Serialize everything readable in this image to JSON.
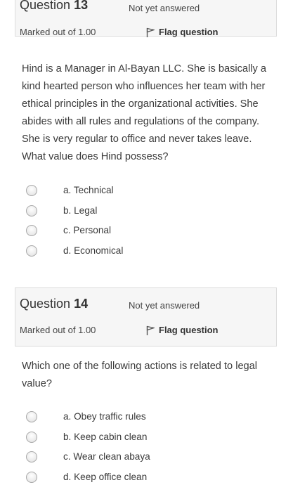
{
  "questions": [
    {
      "label": "Question",
      "number": "13",
      "state": "Not yet answered",
      "grade": "Marked out of 1.00",
      "flag_label": "Flag question",
      "text": "Hind is a Manager in Al-Bayan LLC. She is basically a kind hearted person who influences her team with her ethical principles in the organizational activities. She abides with all rules and regulations of the company. She is very regular to office and never takes leave. What value does Hind possess?",
      "answers": [
        "a. Technical",
        "b. Legal",
        "c. Personal",
        "d. Economical"
      ]
    },
    {
      "label": "Question",
      "number": "14",
      "state": "Not yet answered",
      "grade": "Marked out of 1.00",
      "flag_label": "Flag question",
      "text": "Which one of the following actions is related to legal value?",
      "answers": [
        "a. Obey traffic rules",
        "b. Keep cabin clean",
        "c. Wear clean abaya",
        "d. Keep office clean"
      ]
    }
  ],
  "icons": {
    "flag": "flag-icon",
    "radio": "radio-unchecked"
  }
}
